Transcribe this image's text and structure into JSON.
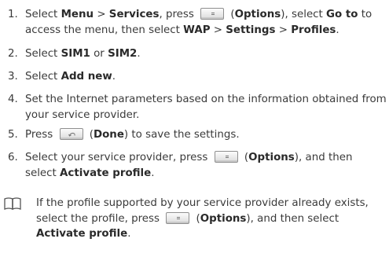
{
  "steps": [
    {
      "num": "1.",
      "a": "Select ",
      "b1": "Menu",
      "c": " > ",
      "b2": "Services",
      "d": ", press ",
      "e": " (",
      "b3": "Options",
      "f": "), select ",
      "b4": "Go to",
      "g": " to access the menu, then select ",
      "b5": "WAP",
      "h": " > ",
      "b6": "Settings",
      "i": " > ",
      "b7": "Profiles",
      "j": "."
    },
    {
      "num": "2.",
      "a": "Select ",
      "b1": "SIM1",
      "c": " or ",
      "b2": "SIM2",
      "d": "."
    },
    {
      "num": "3.",
      "a": "Select ",
      "b1": "Add new",
      "c": "."
    },
    {
      "num": "4.",
      "a": "Set the Internet parameters based on the information obtained from your service provider."
    },
    {
      "num": "5.",
      "a": "Press ",
      "b": " (",
      "b1": "Done",
      "c": ") to save the settings."
    },
    {
      "num": "6.",
      "a": "Select your service provider, press ",
      "b": " (",
      "b1": "Options",
      "c": "), and then select ",
      "b2": "Activate profile",
      "d": "."
    }
  ],
  "note": {
    "a": "If the profile supported by your service provider already exists, select the profile, press ",
    "b": " (",
    "b1": "Options",
    "c": "), and then select ",
    "b2": "Activate profile",
    "d": "."
  },
  "icons": {
    "options_key": "options-softkey-icon",
    "done_key": "back-softkey-icon",
    "note": "book-note-icon"
  }
}
